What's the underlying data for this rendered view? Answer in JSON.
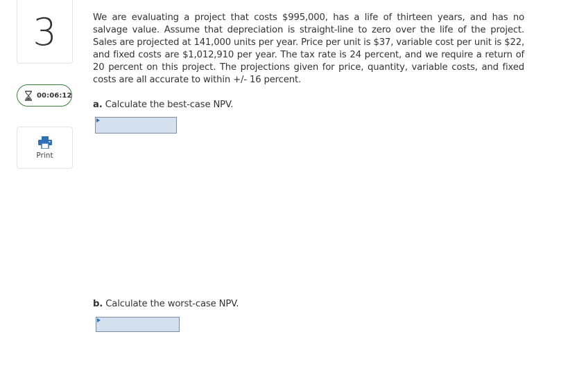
{
  "question": {
    "number": "3",
    "text": "We are evaluating a project that costs $995,000, has a life of thirteen years, and has no salvage value. Assume that depreciation is straight-line to zero over the life of the project. Sales are projected at 141,000 units per year. Price per unit is $37, variable cost per unit is $22, and fixed costs are $1,012,910 per year. The tax rate is 24 percent, and we require a return of 20 percent on this project. The projections given for price, quantity, variable costs, and fixed costs are all accurate to within +/- 16 percent."
  },
  "timer": {
    "icon": "hourglass-icon",
    "value": "00:06:12",
    "border_color": "#3a7d3a"
  },
  "print": {
    "icon": "printer-icon",
    "label": "Print",
    "icon_color": "#2f6fb5"
  },
  "parts": [
    {
      "letter": "a.",
      "prompt": "Calculate the best-case NPV.",
      "answer_value": ""
    },
    {
      "letter": "b.",
      "prompt": "Calculate the worst-case NPV.",
      "answer_value": ""
    }
  ],
  "colors": {
    "input_fill": "#d5e0ee",
    "input_border": "#7c8ca4",
    "text": "#333333"
  }
}
